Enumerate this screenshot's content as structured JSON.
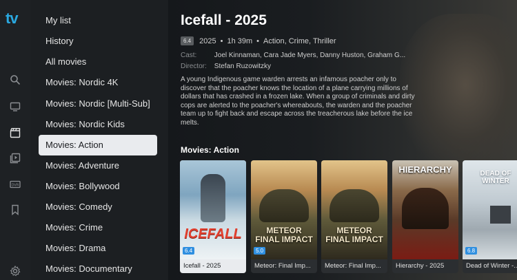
{
  "app": {
    "logo": "tv"
  },
  "rail": [
    {
      "icon": "search-icon"
    },
    {
      "icon": "tv-icon"
    },
    {
      "icon": "movie-clapper-icon"
    },
    {
      "icon": "series-icon"
    },
    {
      "icon": "dvr-icon"
    },
    {
      "icon": "bookmark-icon"
    },
    {
      "icon": "gear-icon"
    }
  ],
  "categories": [
    "My list",
    "History",
    "All movies",
    "Movies: Nordic 4K",
    "Movies: Nordic [Multi-Sub]",
    "Movies: Nordic Kids",
    "Movies: Action",
    "Movies: Adventure",
    "Movies: Bollywood",
    "Movies: Comedy",
    "Movies: Crime",
    "Movies: Drama",
    "Movies: Documentary"
  ],
  "active_category": "Movies: Action",
  "detail": {
    "title": "Icefall - 2025",
    "rating": "6.4",
    "year": "2025",
    "duration": "1h 39m",
    "genres": "Action, Crime, Thriller",
    "cast_label": "Cast:",
    "cast": "Joel Kinnaman, Cara Jade Myers, Danny Huston, Graham G...",
    "director_label": "Director:",
    "director": "Stefan Ruzowitzky",
    "description": "A young Indigenous game warden arrests an infamous poacher only to discover that the poacher knows the location of a plane carrying millions of dollars that has crashed in a frozen lake. When a group of criminals and dirty cops are alerted to the poacher's whereabouts, the warden and the poacher team up to fight back and escape across the treacherous lake before the ice melts."
  },
  "row": {
    "title": "Movies: Action",
    "items": [
      {
        "caption": "Icefall - 2025",
        "rating": "6.4",
        "poster_text": "ICEFALL",
        "badge_color": "#2f8fe0"
      },
      {
        "caption": "Meteor: Final Imp...",
        "rating": "5.0",
        "poster_text": "METEOR\nFINAL IMPACT",
        "badge_color": "#2f8fe0"
      },
      {
        "caption": "Meteor: Final Imp...",
        "rating": "",
        "poster_text": "METEOR\nFINAL IMPACT",
        "badge_color": ""
      },
      {
        "caption": "Hierarchy - 2025",
        "rating": "",
        "poster_text": "HIERARCHY",
        "badge_color": ""
      },
      {
        "caption": "Dead of Winter -...",
        "rating": "6.8",
        "poster_text": "DEAD OF\nWINTER",
        "badge_color": "#2f8fe0"
      }
    ]
  }
}
